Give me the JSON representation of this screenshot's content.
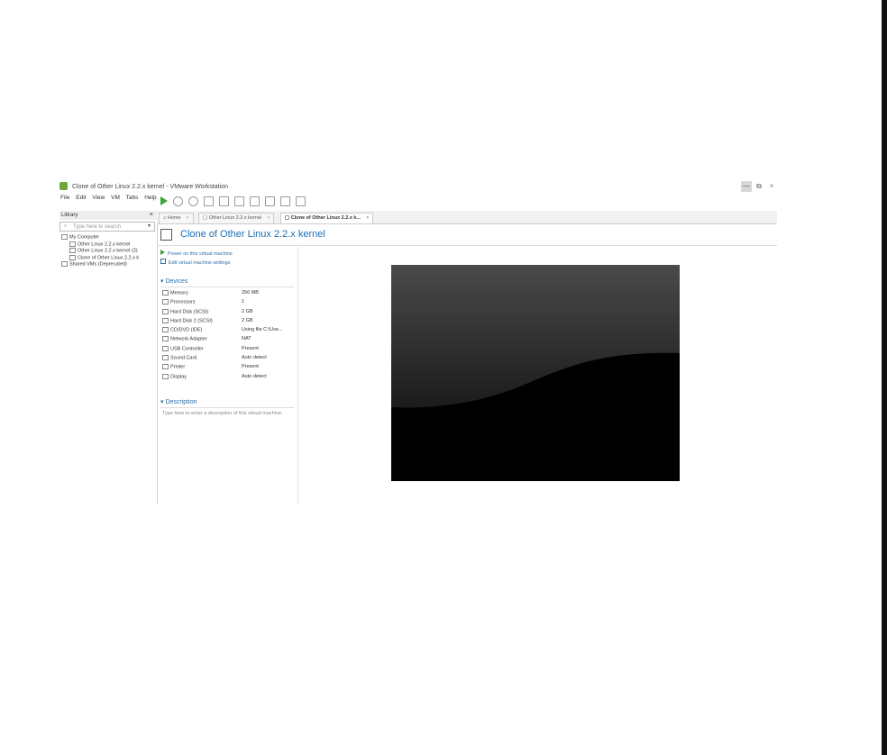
{
  "window": {
    "title": "Clone of Other Linux 2.2.x kernel - VMware Workstation",
    "controls": {
      "minimize": "—",
      "maximize": "⧉",
      "close": "×"
    }
  },
  "menu": [
    "File",
    "Edit",
    "View",
    "VM",
    "Tabs",
    "Help"
  ],
  "library": {
    "title": "Library",
    "close": "×",
    "search_placeholder": "Type here to search",
    "tree": [
      "My Computer",
      "Other Linux 2.2.x kernel",
      "Other Linux 2.2.x kernel (2)",
      "Clone of Other Linux 2.2.x k",
      "Shared VMs (Deprecated)"
    ]
  },
  "tabs": [
    {
      "label": "Home",
      "active": false
    },
    {
      "label": "Other Linux 2.2.x kernel",
      "active": false
    },
    {
      "label": "Clone of Other Linux 2.2.x k...",
      "active": true
    }
  ],
  "vm": {
    "title": "Clone of Other Linux 2.2.x kernel",
    "actions": {
      "power_on": "Power on this virtual machine",
      "edit_settings": "Edit virtual machine settings"
    },
    "devices_heading": "Devices",
    "devices": [
      {
        "name": "Memory",
        "value": "256 MB"
      },
      {
        "name": "Processors",
        "value": "1"
      },
      {
        "name": "Hard Disk (SCSI)",
        "value": "2 GB"
      },
      {
        "name": "Hard Disk 2 (SCSI)",
        "value": "2 GB"
      },
      {
        "name": "CD/DVD (IDE)",
        "value": "Using file C:\\Use..."
      },
      {
        "name": "Network Adapter",
        "value": "NAT"
      },
      {
        "name": "USB Controller",
        "value": "Present"
      },
      {
        "name": "Sound Card",
        "value": "Auto detect"
      },
      {
        "name": "Printer",
        "value": "Present"
      },
      {
        "name": "Display",
        "value": "Auto detect"
      }
    ],
    "description_heading": "Description",
    "description_placeholder": "Type here to enter a description of this virtual machine."
  },
  "colors": {
    "accent": "#1c6fb5",
    "power_green": "#3aa33a",
    "screen": "#000000"
  }
}
